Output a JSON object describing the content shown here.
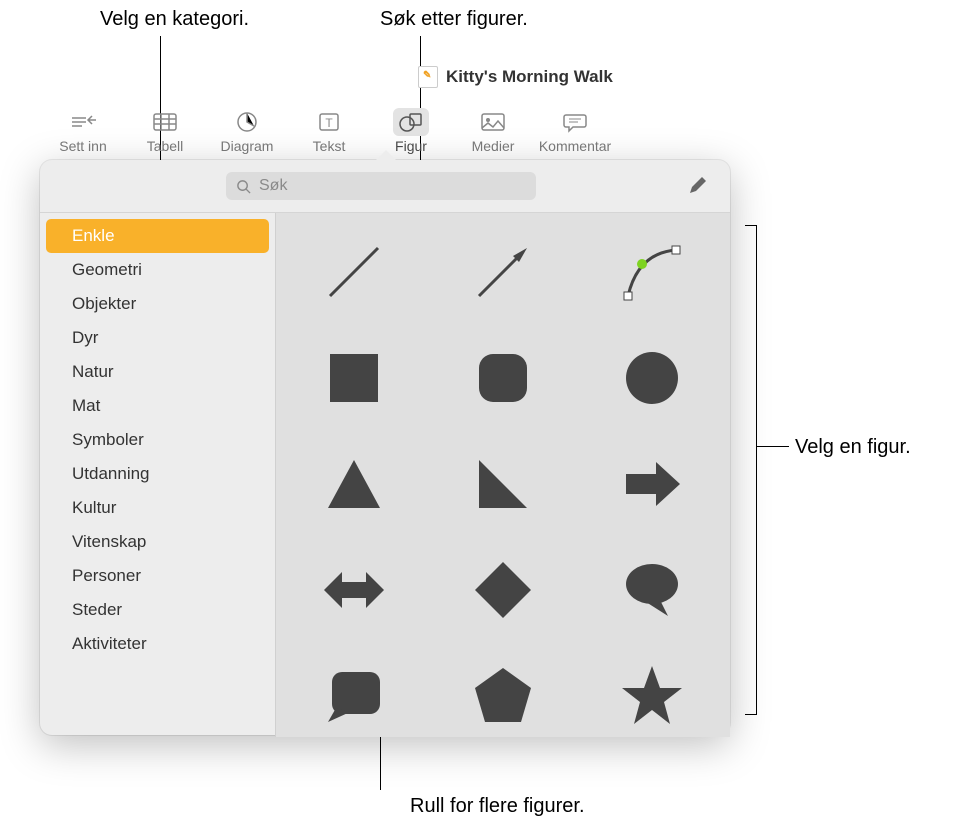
{
  "callouts": {
    "category": "Velg en kategori.",
    "search": "Søk etter figurer.",
    "pick": "Velg en figur.",
    "scroll": "Rull for flere figurer."
  },
  "document": {
    "title": "Kitty's Morning Walk"
  },
  "toolbar": {
    "insert": "Sett inn",
    "table": "Tabell",
    "chart": "Diagram",
    "text": "Tekst",
    "shape": "Figur",
    "media": "Medier",
    "comment": "Kommentar"
  },
  "search": {
    "placeholder": "Søk"
  },
  "categories": [
    "Enkle",
    "Geometri",
    "Objekter",
    "Dyr",
    "Natur",
    "Mat",
    "Symboler",
    "Utdanning",
    "Kultur",
    "Vitenskap",
    "Personer",
    "Steder",
    "Aktiviteter"
  ],
  "shapes": [
    "line",
    "arrow-line",
    "curve",
    "square",
    "rounded-square",
    "circle",
    "triangle",
    "right-triangle",
    "arrow-right",
    "double-arrow",
    "diamond",
    "speech-bubble",
    "callout-box",
    "pentagon",
    "star"
  ]
}
